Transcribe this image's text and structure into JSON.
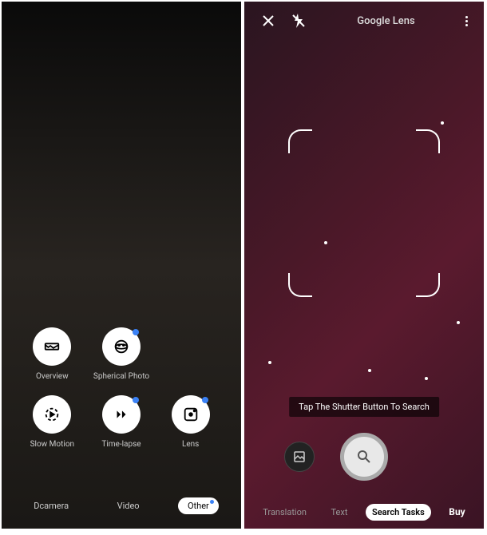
{
  "left": {
    "modes": {
      "overview": "Overview",
      "spherical": "Spherical Photo",
      "slowmo": "Slow Motion",
      "timelapse": "Time-lapse",
      "lens": "Lens"
    },
    "tabs": {
      "camera": "Dcamera",
      "video": "Video",
      "other": "Other"
    }
  },
  "right": {
    "title": "Google Lens",
    "tooltip": "Tap The Shutter Button To Search",
    "modes": {
      "translation": "Translation",
      "text": "Text",
      "search": "Search Tasks",
      "buy": "Buy"
    }
  }
}
